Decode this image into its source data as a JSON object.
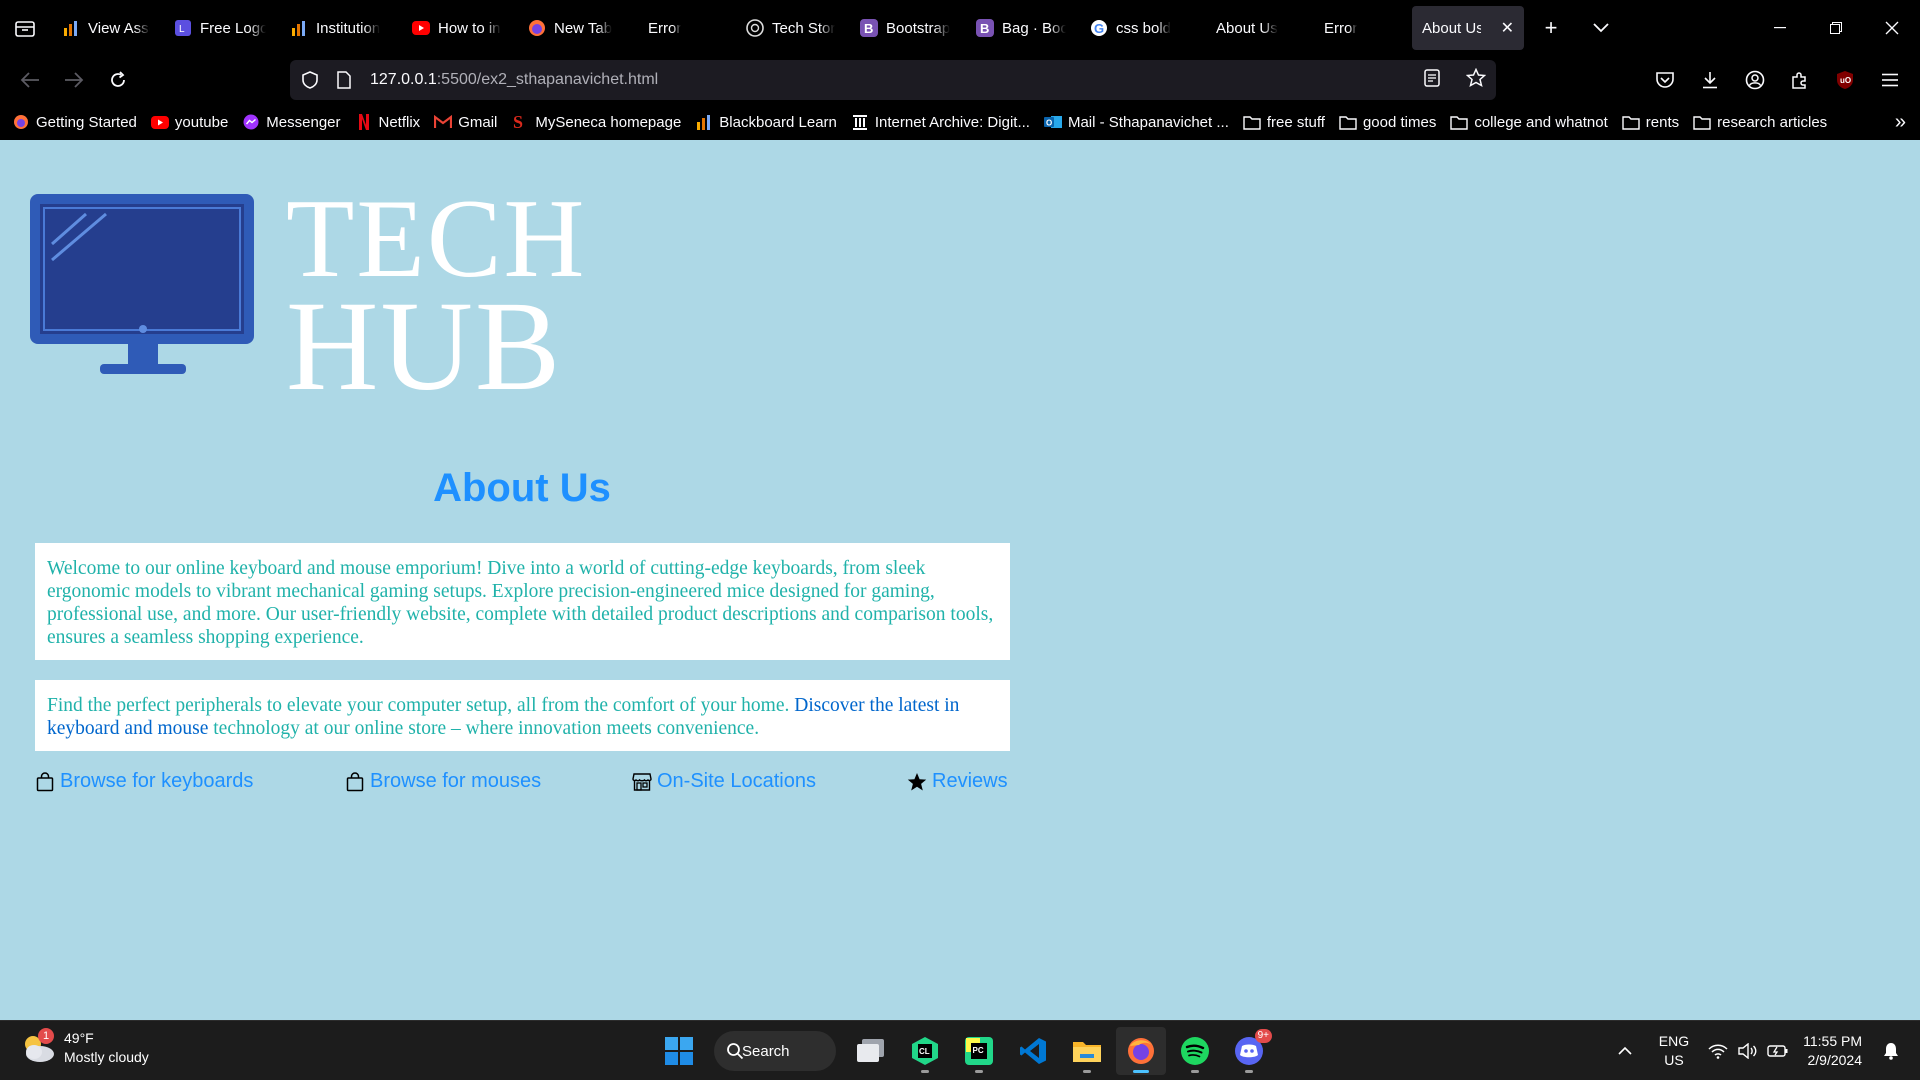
{
  "browser": {
    "tabs": [
      {
        "title": "View Asse",
        "icon": "analytics-icon"
      },
      {
        "title": "Free Logo",
        "icon": "logo-maker-icon"
      },
      {
        "title": "Institution",
        "icon": "analytics-icon"
      },
      {
        "title": "How to in",
        "icon": "youtube-icon"
      },
      {
        "title": "New Tab",
        "icon": "firefox-icon"
      },
      {
        "title": "Error",
        "icon": ""
      },
      {
        "title": "Tech Stor",
        "icon": "chatgpt-icon"
      },
      {
        "title": "Bootstrap",
        "icon": "bootstrap-icon"
      },
      {
        "title": "Bag · Boo",
        "icon": "bootstrap-icon"
      },
      {
        "title": "css bold",
        "icon": "google-icon"
      },
      {
        "title": "About Us",
        "icon": ""
      },
      {
        "title": "Error",
        "icon": ""
      },
      {
        "title": "About Us",
        "icon": "",
        "active": true
      }
    ],
    "url_host": "127.0.0.1",
    "url_path": ":5500/ex2_sthapanavichet.html",
    "bookmarks": [
      {
        "label": "Getting Started",
        "icon": "firefox-icon"
      },
      {
        "label": "youtube",
        "icon": "youtube-icon"
      },
      {
        "label": "Messenger",
        "icon": "messenger-icon"
      },
      {
        "label": "Netflix",
        "icon": "netflix-icon"
      },
      {
        "label": "Gmail",
        "icon": "gmail-icon"
      },
      {
        "label": "MySeneca homepage",
        "icon": "seneca-icon"
      },
      {
        "label": "Blackboard Learn",
        "icon": "analytics-icon"
      },
      {
        "label": "Internet Archive: Digit...",
        "icon": "archive-icon"
      },
      {
        "label": "Mail - Sthapanavichet ...",
        "icon": "outlook-icon"
      },
      {
        "label": "free stuff",
        "icon": "folder-icon"
      },
      {
        "label": "good times",
        "icon": "folder-icon"
      },
      {
        "label": "college and whatnot",
        "icon": "folder-icon"
      },
      {
        "label": "rents",
        "icon": "folder-icon"
      },
      {
        "label": "research articles",
        "icon": "folder-icon"
      }
    ]
  },
  "page": {
    "logo_line1": "TECH",
    "logo_line2": "HUB",
    "title": "About Us",
    "para1": "Welcome to our online keyboard and mouse emporium! Dive into a world of cutting-edge keyboards, from sleek ergonomic models to vibrant mechanical gaming setups. Explore precision-engineered mice designed for gaming, professional use, and more. Our user-friendly website, complete with detailed product descriptions and comparison tools, ensures a seamless shopping experience.",
    "para2_before": "Find the perfect peripherals to elevate your computer setup, all from the comfort of your home. ",
    "para2_highlight": "Discover the latest in keyboard and mouse",
    "para2_after": " technology at our online store – where innovation meets convenience.",
    "links": {
      "keyboards": "Browse for keyboards",
      "mouses": "Browse for mouses",
      "locations": "On-Site Locations",
      "reviews": "Reviews"
    },
    "colors": {
      "background": "#add8e6",
      "title": "#1e90ff",
      "paragraph": "#20b2aa",
      "highlight": "#0066cc",
      "link": "#1e90ff"
    }
  },
  "taskbar": {
    "weather_temp": "49°F",
    "weather_desc": "Mostly cloudy",
    "weather_badge": "1",
    "search_label": "Search",
    "apps": [
      "task-view-icon",
      "clion-icon",
      "pycharm-icon",
      "vscode-icon",
      "file-explorer-icon",
      "firefox-icon",
      "spotify-icon",
      "discord-icon"
    ],
    "discord_badge": "9+",
    "lang_line1": "ENG",
    "lang_line2": "US",
    "time": "11:55 PM",
    "date": "2/9/2024"
  }
}
